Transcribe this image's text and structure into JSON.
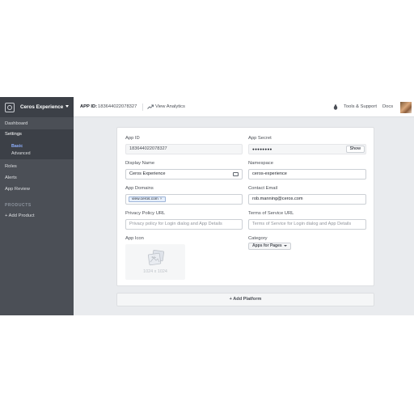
{
  "sidebar": {
    "app_name": "Ceros Experience",
    "items": {
      "dashboard": "Dashboard",
      "settings": "Settings",
      "basic": "Basic",
      "advanced": "Advanced",
      "roles": "Roles",
      "alerts": "Alerts",
      "app_review": "App Review"
    },
    "products_heading": "PRODUCTS",
    "add_product": "+ Add Product"
  },
  "topbar": {
    "app_id_label": "APP ID:",
    "app_id_value": "183644022078327",
    "view_analytics": "View Analytics",
    "tools_support": "Tools & Support",
    "docs": "Docs"
  },
  "form": {
    "app_id": {
      "label": "App ID",
      "value": "183644022078327"
    },
    "app_secret": {
      "label": "App Secret",
      "value": "●●●●●●●●",
      "button": "Show"
    },
    "display_name": {
      "label": "Display Name",
      "value": "Ceros Experience"
    },
    "namespace": {
      "label": "Namespace",
      "value": "ceros-experience"
    },
    "app_domains": {
      "label": "App Domains",
      "tag": "view.ceros.com",
      "tag_remove": "×"
    },
    "contact_email": {
      "label": "Contact Email",
      "value": "rob.manning@ceros.com"
    },
    "privacy_policy": {
      "label": "Privacy Policy URL",
      "placeholder": "Privacy policy for Login dialog and App Details"
    },
    "terms_of_service": {
      "label": "Terms of Service URL",
      "placeholder": "Terms of Service for Login dialog and App Details"
    },
    "app_icon": {
      "label": "App Icon",
      "size_hint": "1024 x 1024"
    },
    "category": {
      "label": "Category",
      "value": "Apps for Pages"
    }
  },
  "add_platform": "+ Add Platform",
  "icons": {
    "app_logo": "cube-icon",
    "analytics": "trend-arrow-icon",
    "support": "bug-icon",
    "display_name": "card-icon",
    "app_icon": "image-placeholder-icon"
  },
  "colors": {
    "sidebar_bg": "#4b4f56",
    "sidebar_active": "#3c4047",
    "active_link": "#8fb0ff",
    "content_bg": "#e9ebee"
  }
}
